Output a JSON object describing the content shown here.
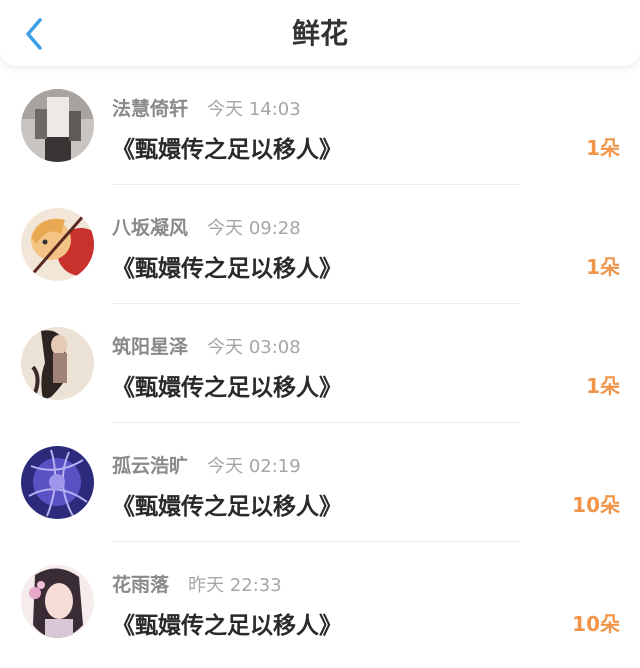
{
  "header": {
    "title": "鲜花",
    "back_icon": "chevron-left-icon",
    "accent_color": "#3a9ee8"
  },
  "gifts": [
    {
      "name": "法慧倚轩",
      "time": "今天 14:03",
      "work": "《甄嬛传之足以移人》",
      "count": "1朵"
    },
    {
      "name": "八坂凝风",
      "time": "今天 09:28",
      "work": "《甄嬛传之足以移人》",
      "count": "1朵"
    },
    {
      "name": "筑阳星泽",
      "time": "今天 03:08",
      "work": "《甄嬛传之足以移人》",
      "count": "1朵"
    },
    {
      "name": "孤云浩旷",
      "time": "今天 02:19",
      "work": "《甄嬛传之足以移人》",
      "count": "10朵"
    },
    {
      "name": "花雨落",
      "time": "昨天 22:33",
      "work": "《甄嬛传之足以移人》",
      "count": "10朵"
    }
  ],
  "colors": {
    "count": "#f0954a",
    "name": "#8a8a8a",
    "time": "#a6a6a6"
  }
}
